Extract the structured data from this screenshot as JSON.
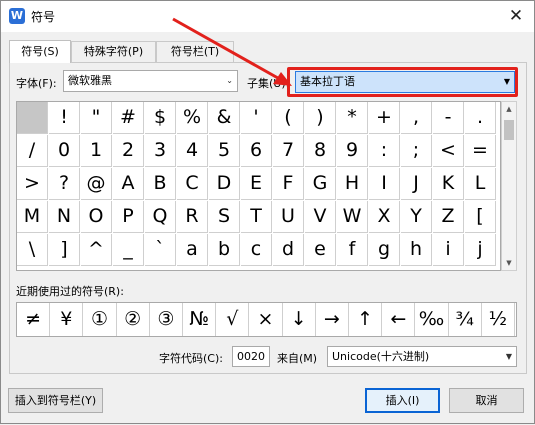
{
  "window": {
    "title": "符号",
    "app_icon_letter": "W"
  },
  "tabs": [
    {
      "label": "符号(S)",
      "active": true
    },
    {
      "label": "特殊字符(P)",
      "active": false
    },
    {
      "label": "符号栏(T)",
      "active": false
    }
  ],
  "font": {
    "label": "字体(F):",
    "value": "微软雅黑"
  },
  "subset": {
    "label": "子集(U):",
    "value": "基本拉丁语"
  },
  "symbols": [
    "",
    "!",
    "\"",
    "#",
    "$",
    "%",
    "&",
    "'",
    "(",
    ")",
    "*",
    "+",
    ",",
    "-",
    ".",
    "/",
    "0",
    "1",
    "2",
    "3",
    "4",
    "5",
    "6",
    "7",
    "8",
    "9",
    ":",
    ";",
    "<",
    "=",
    ">",
    "?",
    "@",
    "A",
    "B",
    "C",
    "D",
    "E",
    "F",
    "G",
    "H",
    "I",
    "J",
    "K",
    "L",
    "M",
    "N",
    "O",
    "P",
    "Q",
    "R",
    "S",
    "T",
    "U",
    "V",
    "W",
    "X",
    "Y",
    "Z",
    "[",
    "\\",
    "]",
    "^",
    "_",
    "`",
    "a",
    "b",
    "c",
    "d",
    "e",
    "f",
    "g",
    "h",
    "i",
    "j"
  ],
  "recent": {
    "label": "近期使用过的符号(R):",
    "symbols": [
      "≠",
      "¥",
      "①",
      "②",
      "③",
      "№",
      "√",
      "×",
      "↓",
      "→",
      "↑",
      "←",
      "‰",
      "¾",
      "½"
    ]
  },
  "charcode": {
    "label": "字符代码(C):",
    "value": "0020",
    "from_label": "来自(M)",
    "from_value": "Unicode(十六进制)"
  },
  "buttons": {
    "add_to_bar": "插入到符号栏(Y)",
    "insert": "插入(I)",
    "cancel": "取消"
  },
  "colors": {
    "annotation_red": "#e2211c",
    "selection_blue": "#cde3fb",
    "focus_blue": "#0a64d4"
  }
}
